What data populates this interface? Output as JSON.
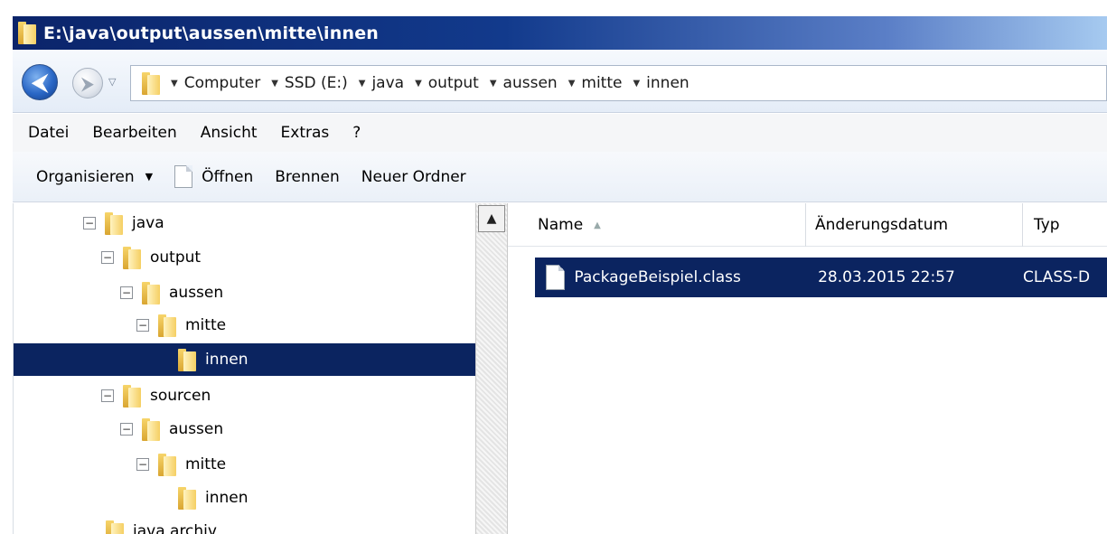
{
  "window": {
    "title": "E:\\java\\output\\aussen\\mitte\\innen"
  },
  "address": {
    "breadcrumbs": [
      "Computer",
      "SSD (E:)",
      "java",
      "output",
      "aussen",
      "mitte",
      "innen"
    ]
  },
  "menu": {
    "items": [
      "Datei",
      "Bearbeiten",
      "Ansicht",
      "Extras",
      "?"
    ]
  },
  "toolbar": {
    "organize_label": "Organisieren",
    "open_label": "Öffnen",
    "burn_label": "Brennen",
    "new_folder_label": "Neuer Ordner"
  },
  "tree": {
    "items": [
      {
        "label": "java",
        "expanded": true
      },
      {
        "label": "output",
        "expanded": true
      },
      {
        "label": "aussen",
        "expanded": true
      },
      {
        "label": "mitte",
        "expanded": true
      },
      {
        "label": "innen",
        "selected": true
      },
      {
        "label": "sourcen",
        "expanded": true
      },
      {
        "label": "aussen",
        "expanded": true
      },
      {
        "label": "mitte",
        "expanded": true
      },
      {
        "label": "innen"
      },
      {
        "label": "java archiv"
      }
    ]
  },
  "columns": {
    "name": "Name",
    "date": "Änderungsdatum",
    "type": "Typ"
  },
  "files": [
    {
      "name": "PackageBeispiel.class",
      "date": "28.03.2015 22:57",
      "type": "CLASS-D"
    }
  ],
  "icons": {
    "back": "back-arrow-icon",
    "forward": "forward-arrow-icon",
    "folder": "folder-icon",
    "file": "file-icon"
  },
  "colors": {
    "selection": "#0b2460",
    "titlebar": "#0b246a"
  }
}
